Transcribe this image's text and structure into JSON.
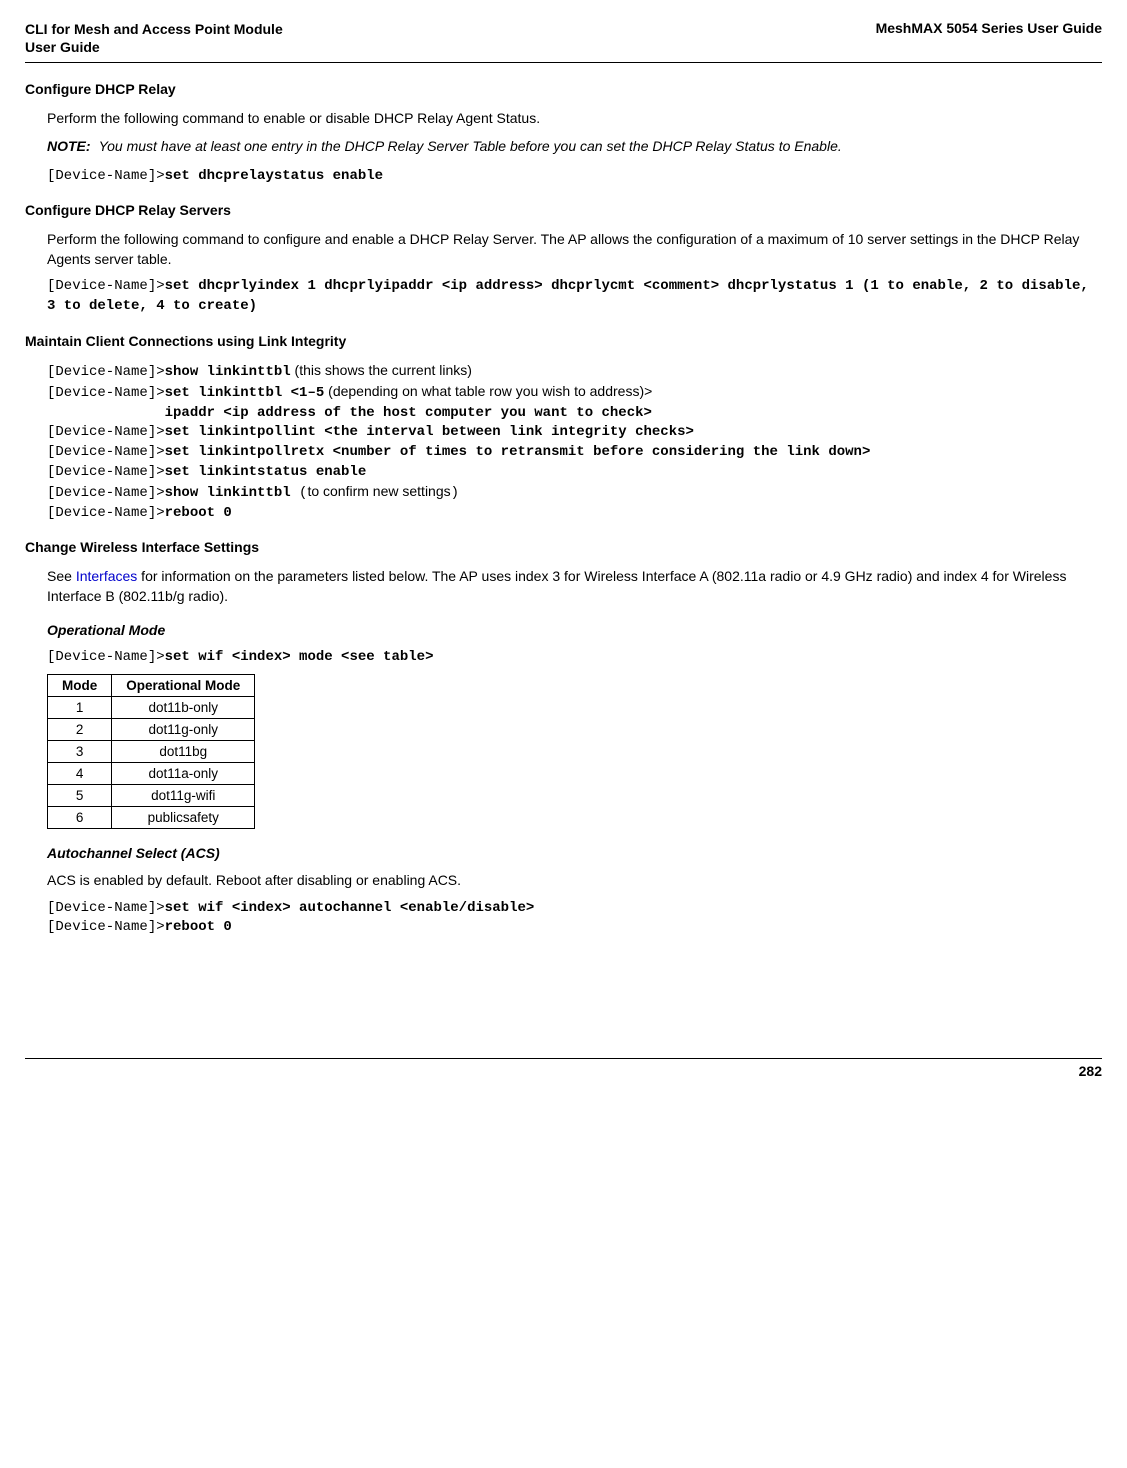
{
  "header": {
    "left_line1": "CLI for Mesh and Access Point Module",
    "left_line2": " User Guide",
    "right": "MeshMAX 5054 Series User Guide"
  },
  "sections": {
    "dhcp_relay": {
      "heading": "Configure DHCP Relay",
      "para1": "Perform the following command to enable or disable DHCP Relay Agent Status.",
      "note_label": "NOTE:",
      "note_text": "You must have at least one entry in the DHCP Relay Server Table before you can set the DHCP Relay Status to Enable.",
      "code_prompt": "[Device-Name]>",
      "code_cmd": "set dhcprelaystatus enable"
    },
    "dhcp_servers": {
      "heading": "Configure DHCP Relay Servers",
      "para1": "Perform the following command to configure and enable a DHCP Relay Server. The AP allows the configuration of a maximum of 10 server settings in the DHCP Relay Agents server table.",
      "code_prompt": "[Device-Name]>",
      "code_line1": "set dhcprlyindex 1 dhcprlyipaddr <ip address> dhcprlycmt <comment> dhcprlystatus 1 (1 to enable, 2 to disable, 3 to delete, 4 to create)"
    },
    "link_integrity": {
      "heading": "Maintain Client Connections using Link Integrity",
      "l1_prompt": "[Device-Name]>",
      "l1_cmd": "show linkinttbl",
      "l1_comment": " (this shows the current links)",
      "l2_prompt": "[Device-Name]>",
      "l2_cmd": "set linkinttbl <1–5",
      "l2_comment": " (depending on what table row you wish to address)",
      "l2_trail": ">",
      "l3_indent": "              ipaddr <ip address of the host computer you want to check>",
      "l4_prompt": "[Device-Name]>",
      "l4_cmd": "set linkintpollint <the interval between link integrity checks>",
      "l5_prompt": "[Device-Name]>",
      "l5_cmd": "set linkintpollretx <number of times to retransmit before considering the link down>",
      "l6_prompt": "[Device-Name]>",
      "l6_cmd": "set linkintstatus enable",
      "l7_prompt": "[Device-Name]>",
      "l7_cmd": "show linkinttbl ",
      "l7_comment": "(to confirm new settings)",
      "l8_prompt": "[Device-Name]>",
      "l8_cmd": "reboot 0"
    },
    "wireless": {
      "heading": "Change Wireless Interface Settings",
      "para_pre": "See ",
      "para_link": "Interfaces",
      "para_post": " for information on the parameters listed below. The AP uses index 3 for Wireless Interface A (802.11a radio or 4.9 GHz radio) and index 4 for Wireless Interface B (802.11b/g radio).",
      "opmode_heading": "Operational Mode",
      "op_prompt": "[Device-Name]>",
      "op_cmd": "set wif <index> mode <see table>",
      "acs_heading": "Autochannel Select (ACS)",
      "acs_para": "ACS is enabled by default. Reboot after disabling or enabling ACS.",
      "acs_prompt1": "[Device-Name]>",
      "acs_cmd1": "set wif <index> autochannel <enable/disable>",
      "acs_prompt2": "[Device-Name]>",
      "acs_cmd2": "reboot 0"
    }
  },
  "mode_table": {
    "headers": [
      "Mode",
      "Operational Mode"
    ],
    "rows": [
      {
        "mode": "1",
        "op": "dot11b-only"
      },
      {
        "mode": "2",
        "op": "dot11g-only"
      },
      {
        "mode": "3",
        "op": "dot11bg"
      },
      {
        "mode": "4",
        "op": "dot11a-only"
      },
      {
        "mode": "5",
        "op": "dot11g-wifi"
      },
      {
        "mode": "6",
        "op": "publicsafety"
      }
    ]
  },
  "footer": {
    "page": "282"
  }
}
